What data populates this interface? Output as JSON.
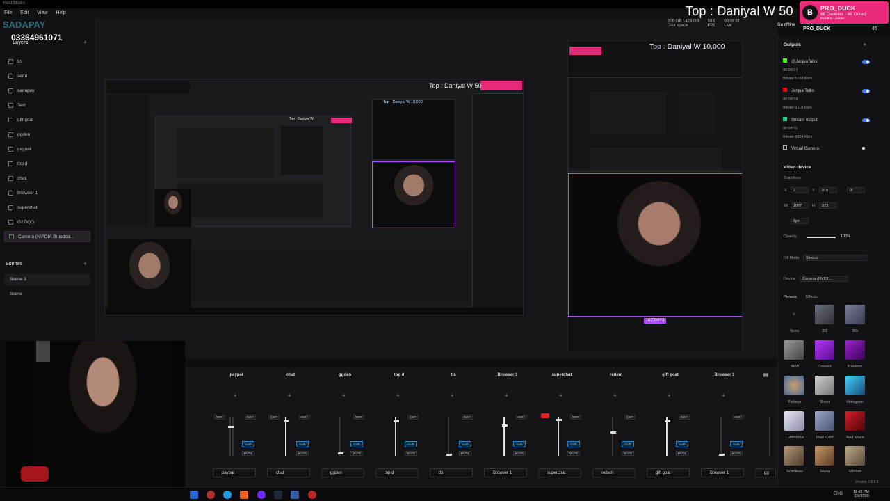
{
  "window_title": "Meld Studio",
  "menu": [
    "File",
    "Edit",
    "View",
    "Help"
  ],
  "overlay": {
    "top_banner": "Top : Daniyal W 50",
    "brand_text": "SADAPAY",
    "phone": "03364961071",
    "pro_duck": {
      "name": "PRO_DUCK",
      "line2": "88 Daddies - 46 Gifted",
      "line3": "Monthly Leader"
    }
  },
  "status": {
    "disk": "209 GB / 478 GB",
    "disk_label": "Disk space",
    "fps": "59.9",
    "fps_label": "FPS",
    "time": "00:08:11",
    "time_label": "Live",
    "go_offline": "Go offline",
    "user": "PRO_DUCK",
    "viewer_count": "46"
  },
  "layers": {
    "title": "Layers",
    "items": [
      "tts",
      "seda",
      "sadapay",
      "Text",
      "gift goat",
      "ggden",
      "paypal",
      "top d",
      "chat",
      "Browser 1",
      "superchat",
      "G27IQG",
      "Camera (NVIDIA Broadca..."
    ]
  },
  "scenes": {
    "title": "Scenes",
    "items": [
      "Scene 3",
      "Scene"
    ]
  },
  "preview": {
    "top_text_mid": "Top : Daniyal W 10,000",
    "top_text_big": "Top : Daniyal W 10,000",
    "size_badge": "1077x873"
  },
  "outputs": {
    "title": "Outputs",
    "items": [
      {
        "name": "@JanjuaTalks",
        "time": "00:08:07",
        "bitrate": "Bitrate 5198 Kb/s"
      },
      {
        "name": "Janjua Talks",
        "time": "00:08:09",
        "bitrate": "Bitrate 5110 Kb/s"
      },
      {
        "name": "Stream output",
        "time": "00:08:11",
        "bitrate": "Bitrate 4894 Kb/s"
      },
      {
        "name": "Virtual Camera"
      }
    ]
  },
  "video_device": {
    "title": "Video device",
    "transform_label": "Transform",
    "x": "2",
    "y": "815",
    "rot": "0°",
    "w": "1077",
    "h": "873",
    "radius": "0px",
    "opacity_label": "Opacity",
    "opacity": "100%",
    "fill_mode_label": "Fill Mode",
    "fill_mode": "Stretch",
    "device_label": "Device",
    "device": "Camera (NVIDI...",
    "tabs": [
      "Presets",
      "Effects"
    ],
    "presets": [
      "None",
      "3D",
      "90s",
      "B&W",
      "Colored",
      "Duotone",
      "Fisheye",
      "Ghost",
      "Hologram",
      "Luminance",
      "Pixel Cam",
      "Red Moon",
      "Scanlines",
      "Sepia",
      "Smooth"
    ]
  },
  "mixer": {
    "channels": [
      "paypal",
      "chat",
      "ggden",
      "top d",
      "tts",
      "Browser 1",
      "superchat",
      "redem",
      "gift goat",
      "Browser 1",
      "gg"
    ],
    "edit_label": "EDIT",
    "mute_label": "MUTE",
    "cue_label": "CUE"
  },
  "taskbar": {
    "lang": "ENG",
    "time": "11:43 PM",
    "date": "2/9/2026"
  },
  "version": "Version 0.9.9.9",
  "colors": {
    "accent_pink": "#e62a7a",
    "accent_purple": "#b14cff",
    "toggle_blue": "#3c7bf2"
  }
}
